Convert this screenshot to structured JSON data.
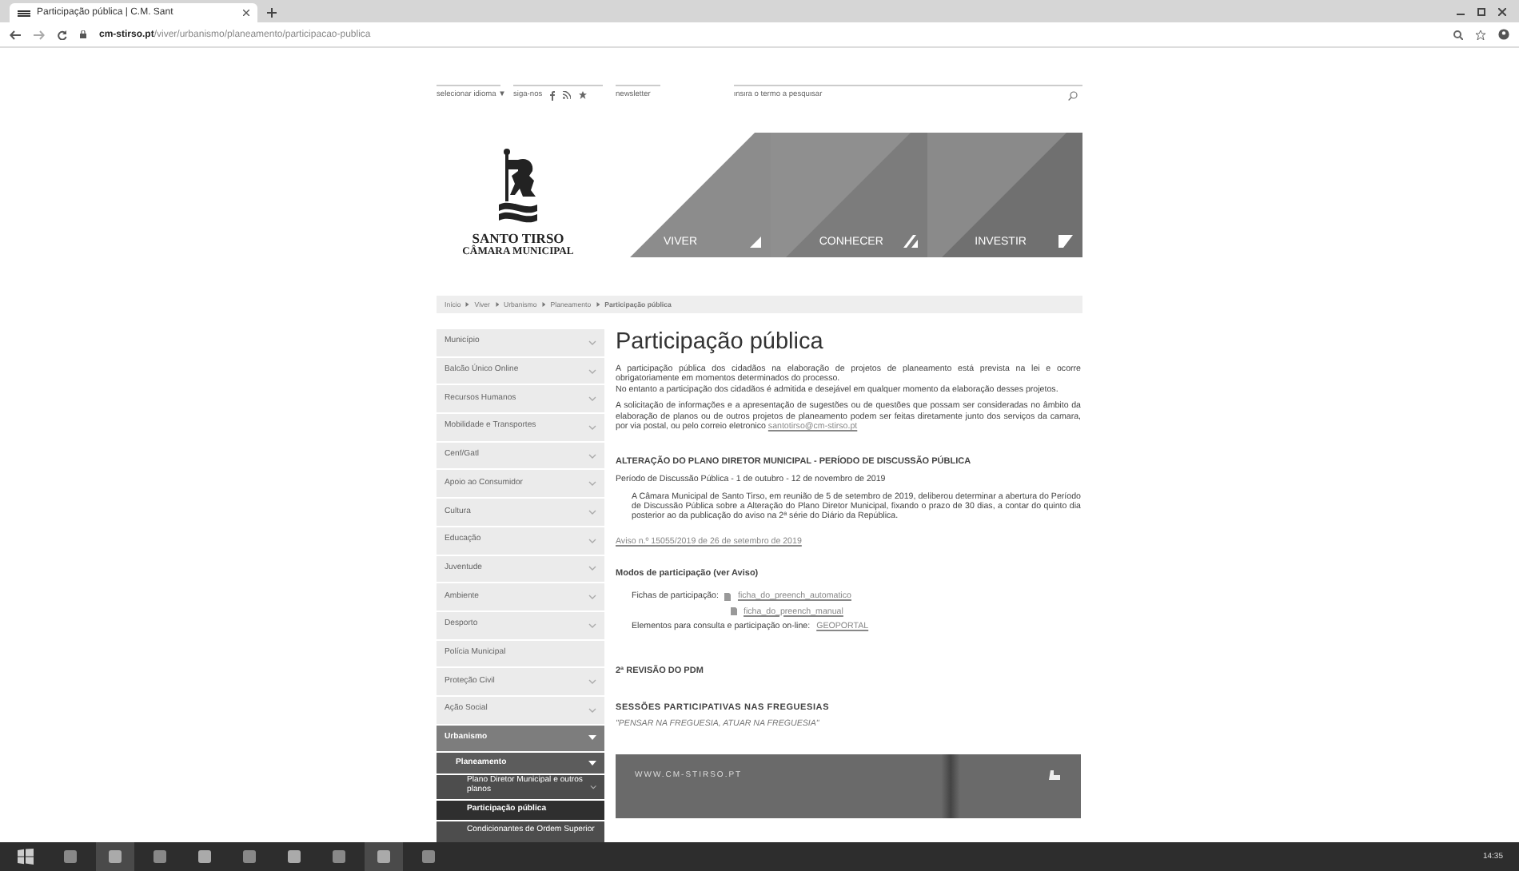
{
  "browser": {
    "tab": {
      "title": "Participação pública | C.M. Sant"
    },
    "address": "**cm-stirso.pt**/viver/urbanismo/planeamento/participacao-publica"
  },
  "utility": {
    "language": "selecionar idioma ▼",
    "follow": "siga-nos",
    "newsletter": "newsletter",
    "search": {
      "placeholder": "insira o termo a pesquisar"
    }
  },
  "logo": {
    "name": "SANTO TIRSO",
    "subtitle": "CÂMARA MUNICIPAL"
  },
  "nav": [
    {
      "label": "VIVER"
    },
    {
      "label": "CONHECER"
    },
    {
      "label": "INVESTIR"
    }
  ],
  "breadcrumb": [
    "Início",
    "Viver",
    "Urbanismo",
    "Planeamento",
    "Participação pública"
  ],
  "sidebar": {
    "items": [
      {
        "label": "Município",
        "expanded": false,
        "selected": false
      },
      {
        "label": "Balcão Único Online",
        "expanded": false,
        "selected": false
      },
      {
        "label": "Recursos Humanos",
        "expanded": false,
        "selected": false
      },
      {
        "label": "Mobilidade e Transportes",
        "expanded": false,
        "selected": false
      },
      {
        "label": "Cenf/Gatl",
        "expanded": false,
        "selected": false
      },
      {
        "label": "Apoio ao Consumidor",
        "expanded": false,
        "selected": false
      },
      {
        "label": "Cultura",
        "expanded": false,
        "selected": false
      },
      {
        "label": "Educação",
        "expanded": false,
        "selected": false
      },
      {
        "label": "Juventude",
        "expanded": false,
        "selected": false
      },
      {
        "label": "Ambiente",
        "expanded": false,
        "selected": false
      },
      {
        "label": "Desporto",
        "expanded": false,
        "selected": false
      },
      {
        "label": "Polícia Municipal",
        "selected": false
      },
      {
        "label": "Proteção Civil",
        "expanded": false,
        "selected": false
      },
      {
        "label": "Ação Social",
        "expanded": false,
        "selected": false
      },
      {
        "label": "Urbanismo",
        "expanded": true,
        "selected": false,
        "children": [
          {
            "label": "Planeamento",
            "expanded": true,
            "selected": false,
            "children": [
              {
                "label": "Plano Diretor Municipal e outros planos",
                "expanded": false,
                "selected": false
              },
              {
                "label": "Participação pública",
                "selected": true
              },
              {
                "label": "Condicionantes de Ordem Superior",
                "selected": false
              }
            ]
          }
        ]
      }
    ]
  },
  "content": {
    "title": "Participação pública",
    "paragraphs": [
      "A participação pública dos cidadãos na elaboração de projetos de planeamento está prevista na lei e ocorre obrigatoriamente em momentos determinados do processo.",
      "No entanto a participação dos cidadãos é admitida e desejável em qualquer momento da elaboração desses projetos."
    ],
    "contact": {
      "text": "A solicitação de informações e a apresentação de sugestões ou de questões que possam ser consideradas no âmbito da elaboração de planos ou de outros projetos de planeamento podem ser feitas diretamente junto dos serviços da camara, por via postal, ou pelo correio eletronico",
      "link": "santotirso@cm-stirso.pt"
    },
    "alteration": {
      "heading": "ALTERAÇÃO DO PLANO DIRETOR MUNICIPAL - PERÍODO DE DISCUSSÃO PÚBLICA",
      "period": "Período de Discussão Pública - 1 de outubro - 12 de novembro de 2019",
      "body": "A Câmara Municipal de Santo Tirso, em reunião de 5 de setembro de 2019, deliberou determinar a abertura do Período de Discussão Pública sobre a Alteração do Plano Diretor Municipal, fixando o prazo de 30 dias, a contar do quinto dia posterior ao da publicação do aviso na 2ª série do Diário da República.",
      "notice_link": "Aviso n.º 15055/2019 de 26 de setembro de 2019",
      "modes": {
        "heading": "Modos de participação (ver Aviso)",
        "forms_label": "Fichas de participação:",
        "forms": [
          "ficha_do_preench_automatico",
          "ficha_do_preench_manual"
        ],
        "online_label": "Elementos para consulta e participação on-line:",
        "online_link": "GEOPORTAL"
      }
    },
    "revision_heading": "2ª REVISÃO DO PDM",
    "sessions": {
      "heading": "SESSÕES PARTICIPATIVAS NAS FREGUESIAS",
      "motto": "\"PENSAR NA FREGUESIA, ATUAR NA FREGUESIA\""
    },
    "banner": {
      "url": "WWW.CM-STIRSO.PT"
    }
  },
  "taskbar": {
    "time": "14:35"
  }
}
